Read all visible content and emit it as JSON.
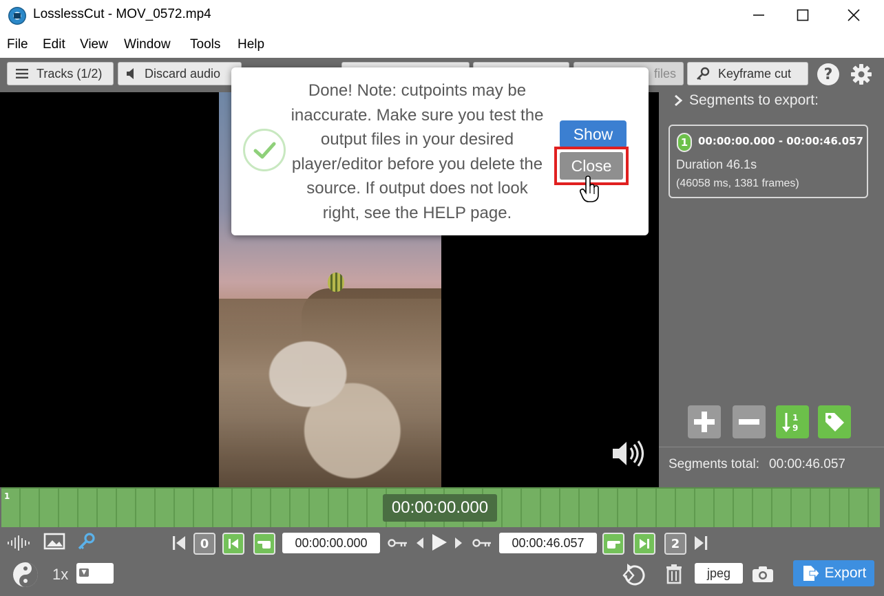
{
  "window": {
    "title": "LosslessCut - MOV_0572.mp4",
    "icon": "losslesscut-app-icon",
    "controls": [
      "minimize-icon",
      "maximize-icon",
      "close-icon"
    ]
  },
  "menu": {
    "items": [
      "File",
      "Edit",
      "View",
      "Window",
      "Tools",
      "Help"
    ]
  },
  "toolbar": {
    "tracks_label": "Tracks (1/2)",
    "discard_audio_label": "Discard audio",
    "files_label": "files",
    "keyframe_cut_label": "Keyframe cut",
    "help_label": "?"
  },
  "notification": {
    "message": "Done! Note: cutpoints may be inaccurate. Make sure you test the output files in your desired player/editor before you delete the source. If output does not look right, see the HELP page.",
    "show_label": "Show",
    "close_label": "Close"
  },
  "sidebar": {
    "header": "Segments to export:",
    "segments": [
      {
        "number": "1",
        "range": "00:00:00.000 - 00:00:46.057",
        "duration": "Duration 46.1s",
        "detail": "(46058 ms, 1381 frames)"
      }
    ],
    "total_label": "Segments total:",
    "total_value": "00:00:46.057"
  },
  "timeline": {
    "segment_number": "1",
    "current_time": "00:00:00.000"
  },
  "controls": {
    "start_segment_number": "0",
    "start_time": "00:00:00.000",
    "end_time": "00:00:46.057",
    "end_segment_number": "2",
    "speed_label": "1x",
    "capture_format": "jpeg",
    "export_label": "Export"
  },
  "colors": {
    "accent_blue": "#3b7fd1",
    "segment_green": "#74b062",
    "highlight_red": "#e02020",
    "panel_grey": "#6b6b6b"
  }
}
